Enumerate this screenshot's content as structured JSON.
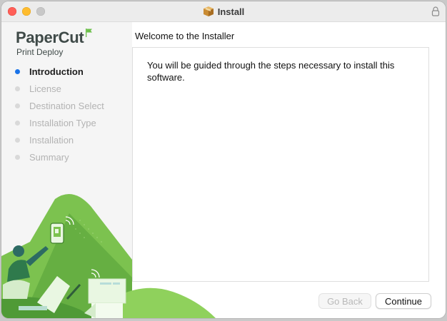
{
  "window": {
    "title": "Install"
  },
  "sidebar": {
    "logo_main": "PaperCut",
    "logo_sub": "Print Deploy",
    "steps": [
      {
        "label": "Introduction",
        "active": true
      },
      {
        "label": "License",
        "active": false
      },
      {
        "label": "Destination Select",
        "active": false
      },
      {
        "label": "Installation Type",
        "active": false
      },
      {
        "label": "Installation",
        "active": false
      },
      {
        "label": "Summary",
        "active": false
      }
    ]
  },
  "main": {
    "heading": "Welcome to the  Installer",
    "body": "You will be guided through the steps necessary to install this software."
  },
  "buttons": {
    "back": "Go Back",
    "continue": "Continue"
  },
  "colors": {
    "active_step": "#1a73e8",
    "brand_green": "#6cc04a"
  }
}
